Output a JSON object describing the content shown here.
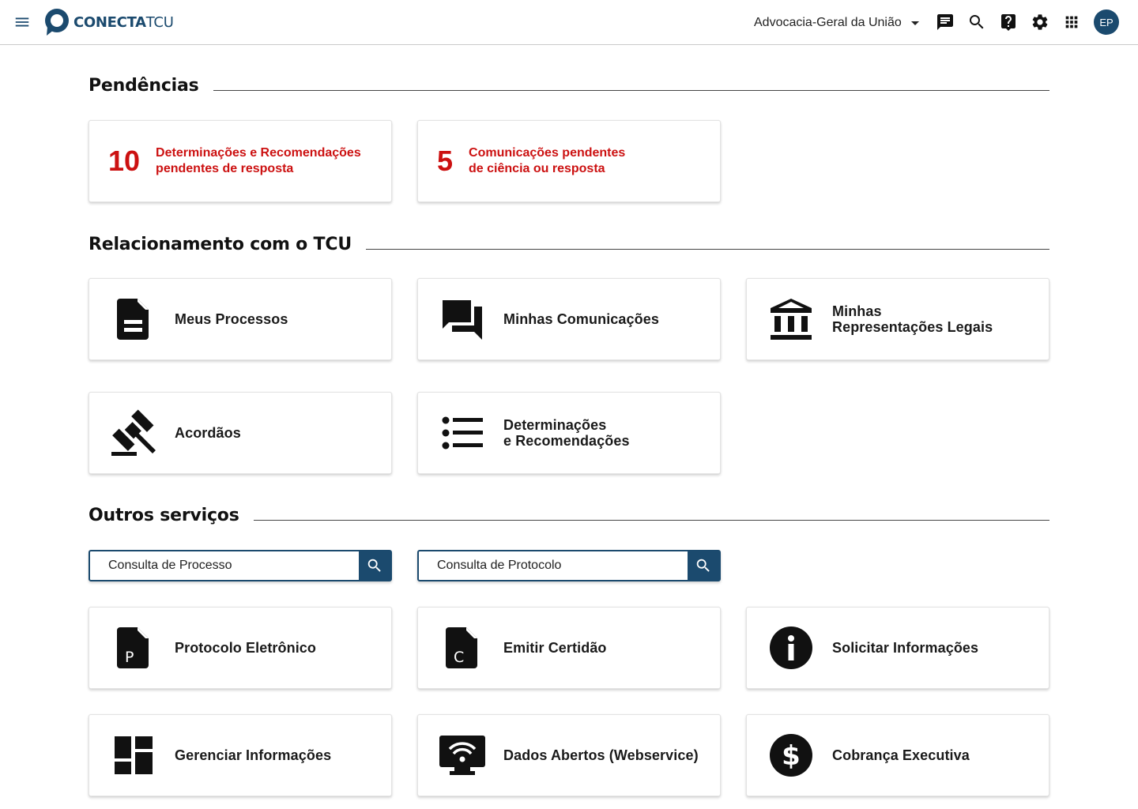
{
  "header": {
    "logo_bold": "CONECTA",
    "logo_light": "TCU",
    "organization": "Advocacia-Geral da União",
    "avatar_initials": "EP",
    "icons": [
      "menu-icon",
      "chat-icon",
      "search-icon",
      "help-icon",
      "settings-icon",
      "apps-icon"
    ]
  },
  "sections": {
    "pendencias": "Pendências",
    "relacionamento": "Relacionamento com o TCU",
    "outros": "Outros serviços"
  },
  "pendencias": [
    {
      "count": "10",
      "line1": "Determinações e Recomendações",
      "line2": "pendentes de resposta"
    },
    {
      "count": "5",
      "line1": "Comunicações pendentes",
      "line2": "de ciência ou resposta"
    }
  ],
  "relacionamento": [
    {
      "icon": "document-icon",
      "line1": "Meus Processos",
      "line2": ""
    },
    {
      "icon": "forum-icon",
      "line1": "Minhas Comunicações",
      "line2": ""
    },
    {
      "icon": "bank-icon",
      "line1": "Minhas",
      "line2": "Representações Legais"
    },
    {
      "icon": "gavel-icon",
      "line1": "Acordãos",
      "line2": ""
    },
    {
      "icon": "list-icon",
      "line1": "Determinações",
      "line2": "e Recomendações"
    }
  ],
  "search": {
    "processo_placeholder": "Consulta de Processo",
    "protocolo_placeholder": "Consulta de Protocolo"
  },
  "outros": [
    {
      "icon": "protocol-file-icon",
      "line1": "Protocolo Eletrônico",
      "letter": "P"
    },
    {
      "icon": "certificate-file-icon",
      "line1": "Emitir Certidão",
      "letter": "C"
    },
    {
      "icon": "info-icon",
      "line1": "Solicitar Informações"
    },
    {
      "icon": "dashboard-icon",
      "line1": "Gerenciar Informações"
    },
    {
      "icon": "webservice-icon",
      "line1": "Dados Abertos (Webservice)"
    },
    {
      "icon": "dollar-icon",
      "line1": "Cobrança Executiva"
    }
  ],
  "colors": {
    "brand": "#1b4a6e",
    "alert": "#cc1111",
    "text": "#1a1a1a"
  }
}
